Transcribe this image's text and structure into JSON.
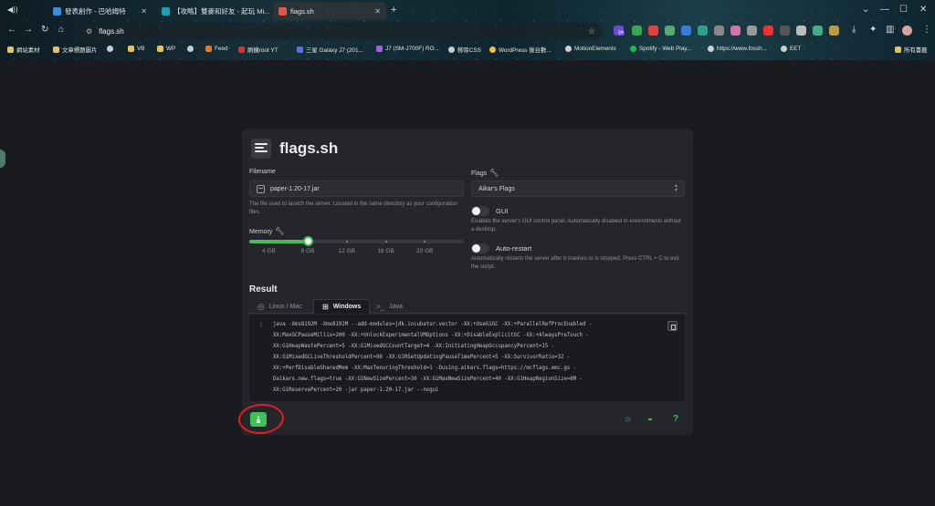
{
  "browser": {
    "tabs": [
      {
        "label": "發表創作 - 巴哈姆特",
        "favicon_color": "#3b8fd9",
        "active": false
      },
      {
        "label": "【攻略】雙麥和好友 - 起玩 Mi...",
        "favicon_color": "#19a1b8",
        "active": false
      },
      {
        "label": "flags.sh",
        "favicon_color": "#e8534c",
        "active": true
      }
    ],
    "new_tab_glyph": "+",
    "window_controls": [
      "⌄",
      "—",
      "☐",
      "✕"
    ],
    "url": "flags.sh",
    "extension_badge": "14",
    "bookmarks": [
      {
        "label": "網站素材",
        "icon_color": "#e0c36a"
      },
      {
        "label": "文章標題圖片",
        "icon_color": "#e0c36a"
      },
      {
        "label": "",
        "icon_color": "#c7cfd2"
      },
      {
        "label": "VB",
        "icon_color": "#e0c36a"
      },
      {
        "label": "WP",
        "icon_color": "#e0c36a"
      },
      {
        "label": "",
        "icon_color": "#c7cfd2"
      },
      {
        "label": "Feed",
        "icon_color": "#e57a2e"
      },
      {
        "label": "刷機root YT",
        "icon_color": "#e52d27"
      },
      {
        "label": "三星 Galaxy J7 (201...",
        "icon_color": "#5a6df0"
      },
      {
        "label": "J7 (SM-J700F) RO...",
        "icon_color": "#9b6ad1"
      },
      {
        "label": "移除CSS",
        "icon_color": "#c7cfd2"
      },
      {
        "label": "WordPress 後台數...",
        "icon_color": "#f0c040"
      },
      {
        "label": "MotionElements",
        "icon_color": "#c7cfd2"
      },
      {
        "label": "Spotify - Web Play...",
        "icon_color": "#1db954"
      },
      {
        "label": "https://www.fossh...",
        "icon_color": "#c7cfd2"
      },
      {
        "label": "EET",
        "icon_color": "#c7cfd2"
      },
      {
        "label": "所有書籤",
        "icon_color": "#e0c36a"
      }
    ]
  },
  "app": {
    "title": "flags.sh",
    "filename": {
      "label": "Filename",
      "value": "paper-1.20-17.jar",
      "description": "The file used to launch the server. Located in the same directory as your configuration files."
    },
    "memory": {
      "label": "Memory",
      "value_gb": 8,
      "min_gb": 2,
      "max_gb": 24,
      "marks": [
        "4 GB",
        "8 GB",
        "12 GB",
        "16 GB",
        "20 GB"
      ]
    },
    "flags": {
      "label": "Flags",
      "selected": "Aikar's Flags",
      "gui": {
        "label": "GUI",
        "enabled": false,
        "description": "Enables the server's GUI control panel. Automatically disabled in environments without a desktop."
      },
      "auto_restart": {
        "label": "Auto-restart",
        "enabled": false,
        "description": "Automatically restarts the server after it crashes or is stopped. Press CTRL + C to exit the script."
      }
    },
    "result": {
      "heading": "Result",
      "tabs": [
        {
          "label": "Linux / Mac",
          "icon": "linux-icon",
          "active": false
        },
        {
          "label": "Windows",
          "icon": "windows-icon",
          "active": true
        },
        {
          "label": "Java",
          "icon": "terminal-icon",
          "active": false
        }
      ],
      "line_number": "1",
      "code_lines": [
        "java -Xms8192M -Xmx8192M --add-modules=jdk.incubator.vector -XX:+UseG1GC -XX:+ParallelRefProcEnabled -",
        "XX:MaxGCPauseMillis=200 -XX:+UnlockExperimentalVMOptions -XX:+DisableExplicitGC -XX:+AlwaysPreTouch -",
        "XX:G1HeapWastePercent=5 -XX:G1MixedGCCountTarget=4 -XX:InitiatingHeapOccupancyPercent=15 -",
        "XX:G1MixedGCLiveThresholdPercent=90 -XX:G1RSetUpdatingPauseTimePercent=5 -XX:SurvivorRatio=32 -",
        "XX:+PerfDisableSharedMem -XX:MaxTenuringThreshold=1 -Dusing.aikars.flags=https://mcflags.emc.gs -",
        "Daikars.new.flags=true -XX:G1NewSizePercent=30 -XX:G1MaxNewSizePercent=40 -XX:G1HeapRegionSize=8M -",
        "XX:G1ReservePercent=20 -jar paper-1.20-17.jar --nogui"
      ]
    },
    "footer": {
      "download_glyph": "⤓",
      "theme_glyph": "☼",
      "github_glyph": "◒",
      "help_glyph": "?"
    }
  },
  "colors": {
    "accent": "#40c057",
    "annotation": "#e02020",
    "background": "#1a1b1e",
    "card": "#25262b"
  }
}
